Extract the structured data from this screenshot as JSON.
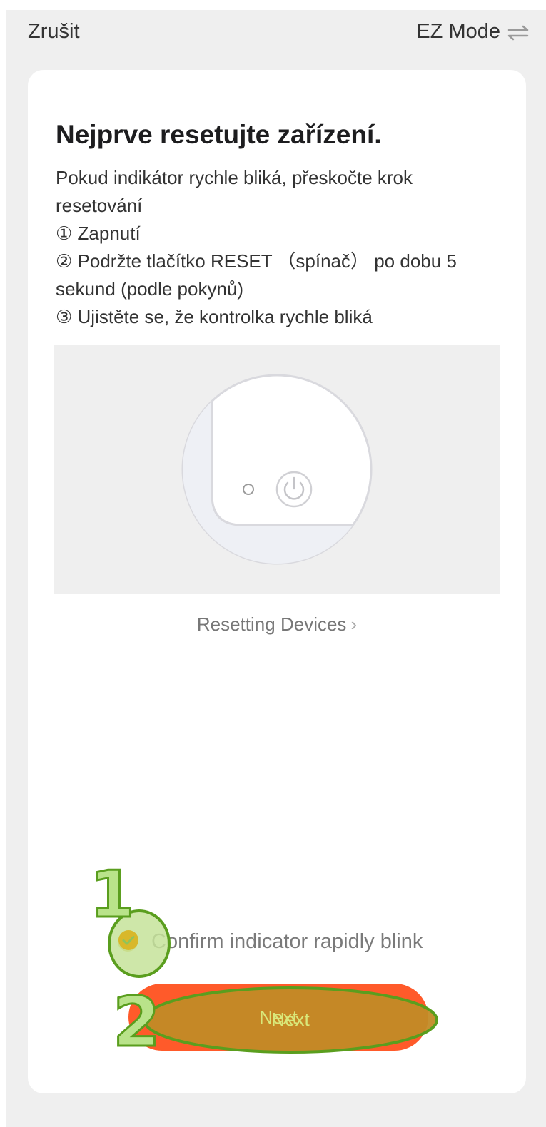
{
  "topbar": {
    "cancel_label": "Zrušit",
    "mode_label": "EZ Mode",
    "mode_icon": "swap-arrows-icon"
  },
  "card": {
    "title": "Nejprve resetujte zařízení.",
    "description": {
      "intro": "Pokud indikátor rychle bliká, přeskočte krok resetování",
      "step1": "① Zapnutí",
      "step2": "② Podržte tlačítko RESET （spínač） po dobu 5 sekund (podle pokynů)",
      "step3": "③ Ujistěte se, že kontrolka rychle bliká"
    },
    "illustration_icon": "device-reset-illustration",
    "reset_link": "Resetting Devices",
    "reset_link_icon": "chevron-right-icon",
    "confirm": {
      "label": "Confirm indicator rapidly blink",
      "checked": true,
      "icon": "check-circle-icon"
    },
    "next_label": "Next"
  },
  "annotations": {
    "marker1": "1",
    "marker2": "2"
  },
  "colors": {
    "accent": "#ff5a2a",
    "background": "#efefef",
    "card": "#ffffff",
    "annotation_green": "#b9e38a",
    "annotation_outline": "#5a9e1e",
    "annotation_fill": "#c28b26"
  }
}
